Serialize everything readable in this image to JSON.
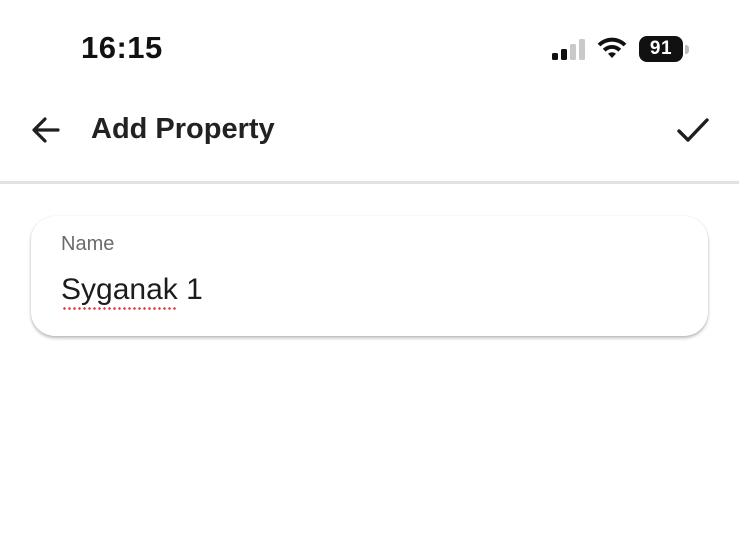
{
  "status_bar": {
    "time": "16:15",
    "signal_bars_active": 2,
    "signal_bars_total": 4,
    "wifi_icon": "wifi-icon",
    "battery_percent": "91"
  },
  "app_bar": {
    "back_icon": "arrow-left-icon",
    "title": "Add Property",
    "confirm_icon": "checkmark-icon"
  },
  "form": {
    "name_field": {
      "label": "Name",
      "value": "Syganak 1",
      "spell_flagged_word": "Syganak"
    }
  },
  "colors": {
    "background": "#ffffff",
    "text_primary": "#222222",
    "label_gray": "#6b6b6b",
    "divider": "#e2e2e2",
    "spellcheck_red": "#e0393e"
  }
}
